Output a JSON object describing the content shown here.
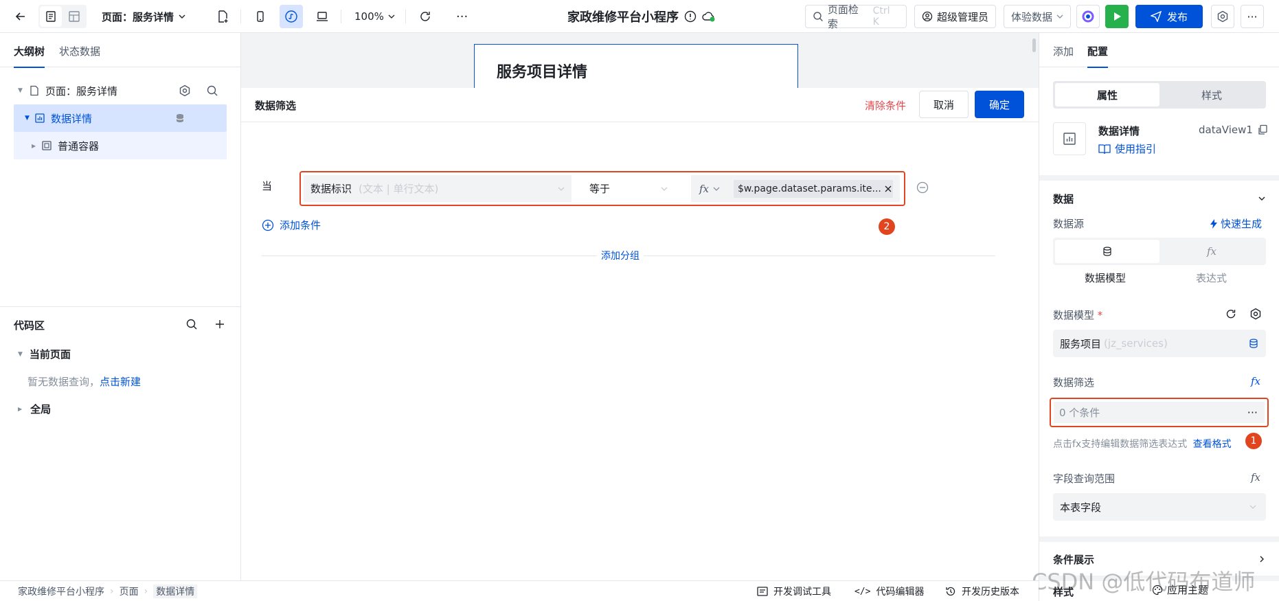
{
  "topbar": {
    "page_label": "页面：服务详情",
    "zoom": "100%",
    "more": "···",
    "app_title": "家政维修平台小程序",
    "search_label": "页面检索",
    "search_shortcut": "Ctrl K",
    "admin": "超级管理员",
    "data_mode": "体验数据",
    "publish": "发布"
  },
  "left": {
    "tabs": [
      "大纲树",
      "状态数据"
    ],
    "tree": {
      "page": "页面：服务详情",
      "data_detail": "数据详情",
      "container": "普通容器"
    },
    "code": {
      "title": "代码区",
      "current_page": "当前页面",
      "empty_text": "暂无数据查询，",
      "create_link": "点击新建",
      "global": "全局"
    }
  },
  "canvas": {
    "page_header": "服务项目详情"
  },
  "filter": {
    "title": "数据筛选",
    "clear": "清除条件",
    "cancel": "取消",
    "confirm": "确定",
    "when": "当",
    "field_name": "数据标识",
    "field_type": "(文本 | 单行文本)",
    "operator": "等于",
    "fx": "fx",
    "expression": "$w.page.dataset.params.ite...",
    "add_condition": "添加条件",
    "add_group": "添加分组",
    "badge": "2"
  },
  "right": {
    "tabs": [
      "添加",
      "配置"
    ],
    "seg": [
      "属性",
      "样式"
    ],
    "component_name": "数据详情",
    "component_id": "dataView1",
    "guide": "使用指引",
    "section_data": "数据",
    "datasource_label": "数据源",
    "quick_generate": "快速生成",
    "source_options": [
      "数据模型",
      "表达式"
    ],
    "model_label": "数据模型",
    "required_mark": "*",
    "model_value": "服务项目",
    "model_id": "(jz_services)",
    "filter_label": "数据筛选",
    "filter_value": "0 个条件",
    "filter_hint": "点击fx支持编辑数据筛选表达式",
    "view_format": "查看格式",
    "badge": "1",
    "query_scope_label": "字段查询范围",
    "query_scope_value": "本表字段",
    "condition_display": "条件展示",
    "cut_label": "样式",
    "apply_theme": "应用主题"
  },
  "statusbar": {
    "breadcrumb": [
      "家政维修平台小程序",
      "页面",
      "数据详情"
    ],
    "debug_tool": "开发调试工具",
    "code_editor": "代码编辑器",
    "history": "开发历史版本"
  },
  "watermark": "CSDN @低代码布道师",
  "colors": {
    "primary": "#0052d9",
    "danger": "#e5484d",
    "badge": "#e0451f",
    "run_green": "#26b14c"
  }
}
